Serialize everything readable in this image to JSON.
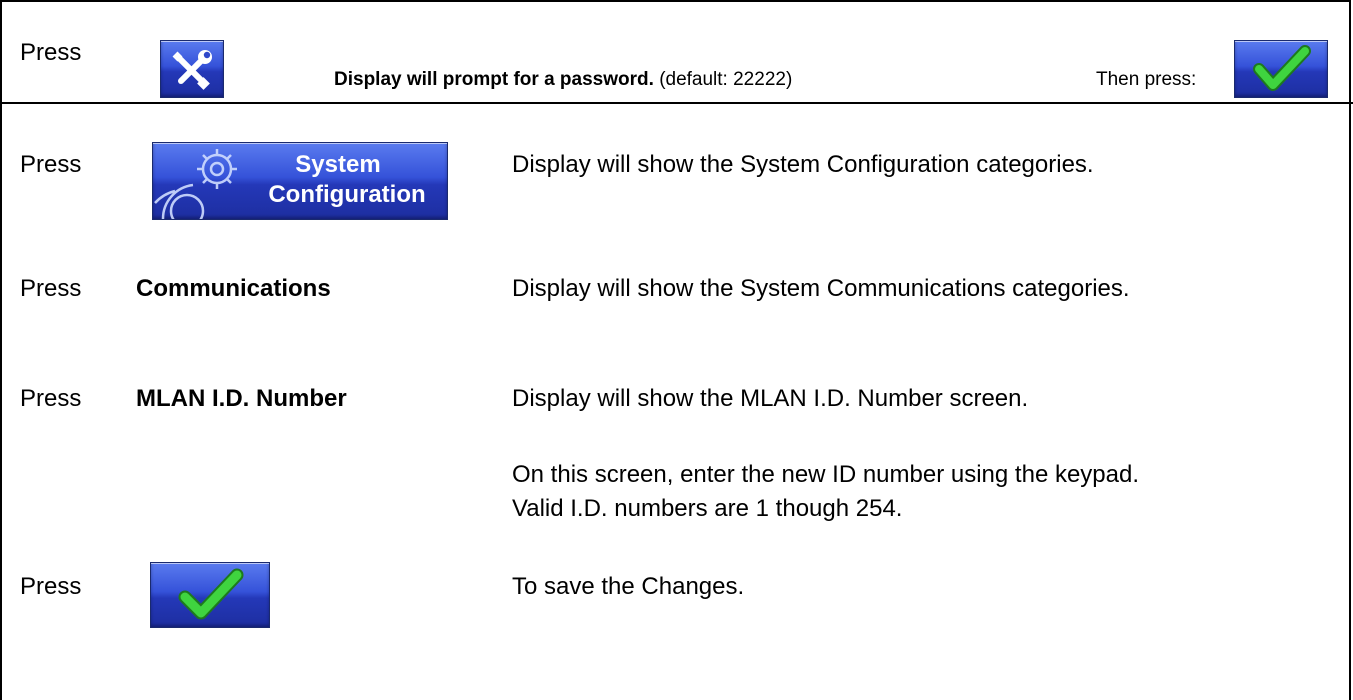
{
  "steps": [
    {
      "press": "Press",
      "prompt_bold": "Display will prompt for a password.",
      "prompt_default": "(default: 22222)",
      "then_press": "Then press:",
      "tools_icon": "tools-icon",
      "confirm_icon": "check-icon"
    },
    {
      "press": "Press",
      "button_line1": "System",
      "button_line2": "Configuration",
      "button_icon": "gear-icon",
      "description": "Display will show the System Configuration categories."
    },
    {
      "press": "Press",
      "item": "Communications",
      "description": "Display will show the System Communications categories."
    },
    {
      "press": "Press",
      "item": "MLAN I.D. Number",
      "description": "Display will show the MLAN I.D. Number screen.",
      "note": "On this screen, enter the new ID number using the keypad.  Valid I.D. numbers are 1 though 254."
    },
    {
      "press": "Press",
      "button_icon": "check-icon",
      "description": "To save the Changes."
    }
  ],
  "colors": {
    "button_blue": "#2f47c9",
    "check_green": "#2fbf2f"
  }
}
